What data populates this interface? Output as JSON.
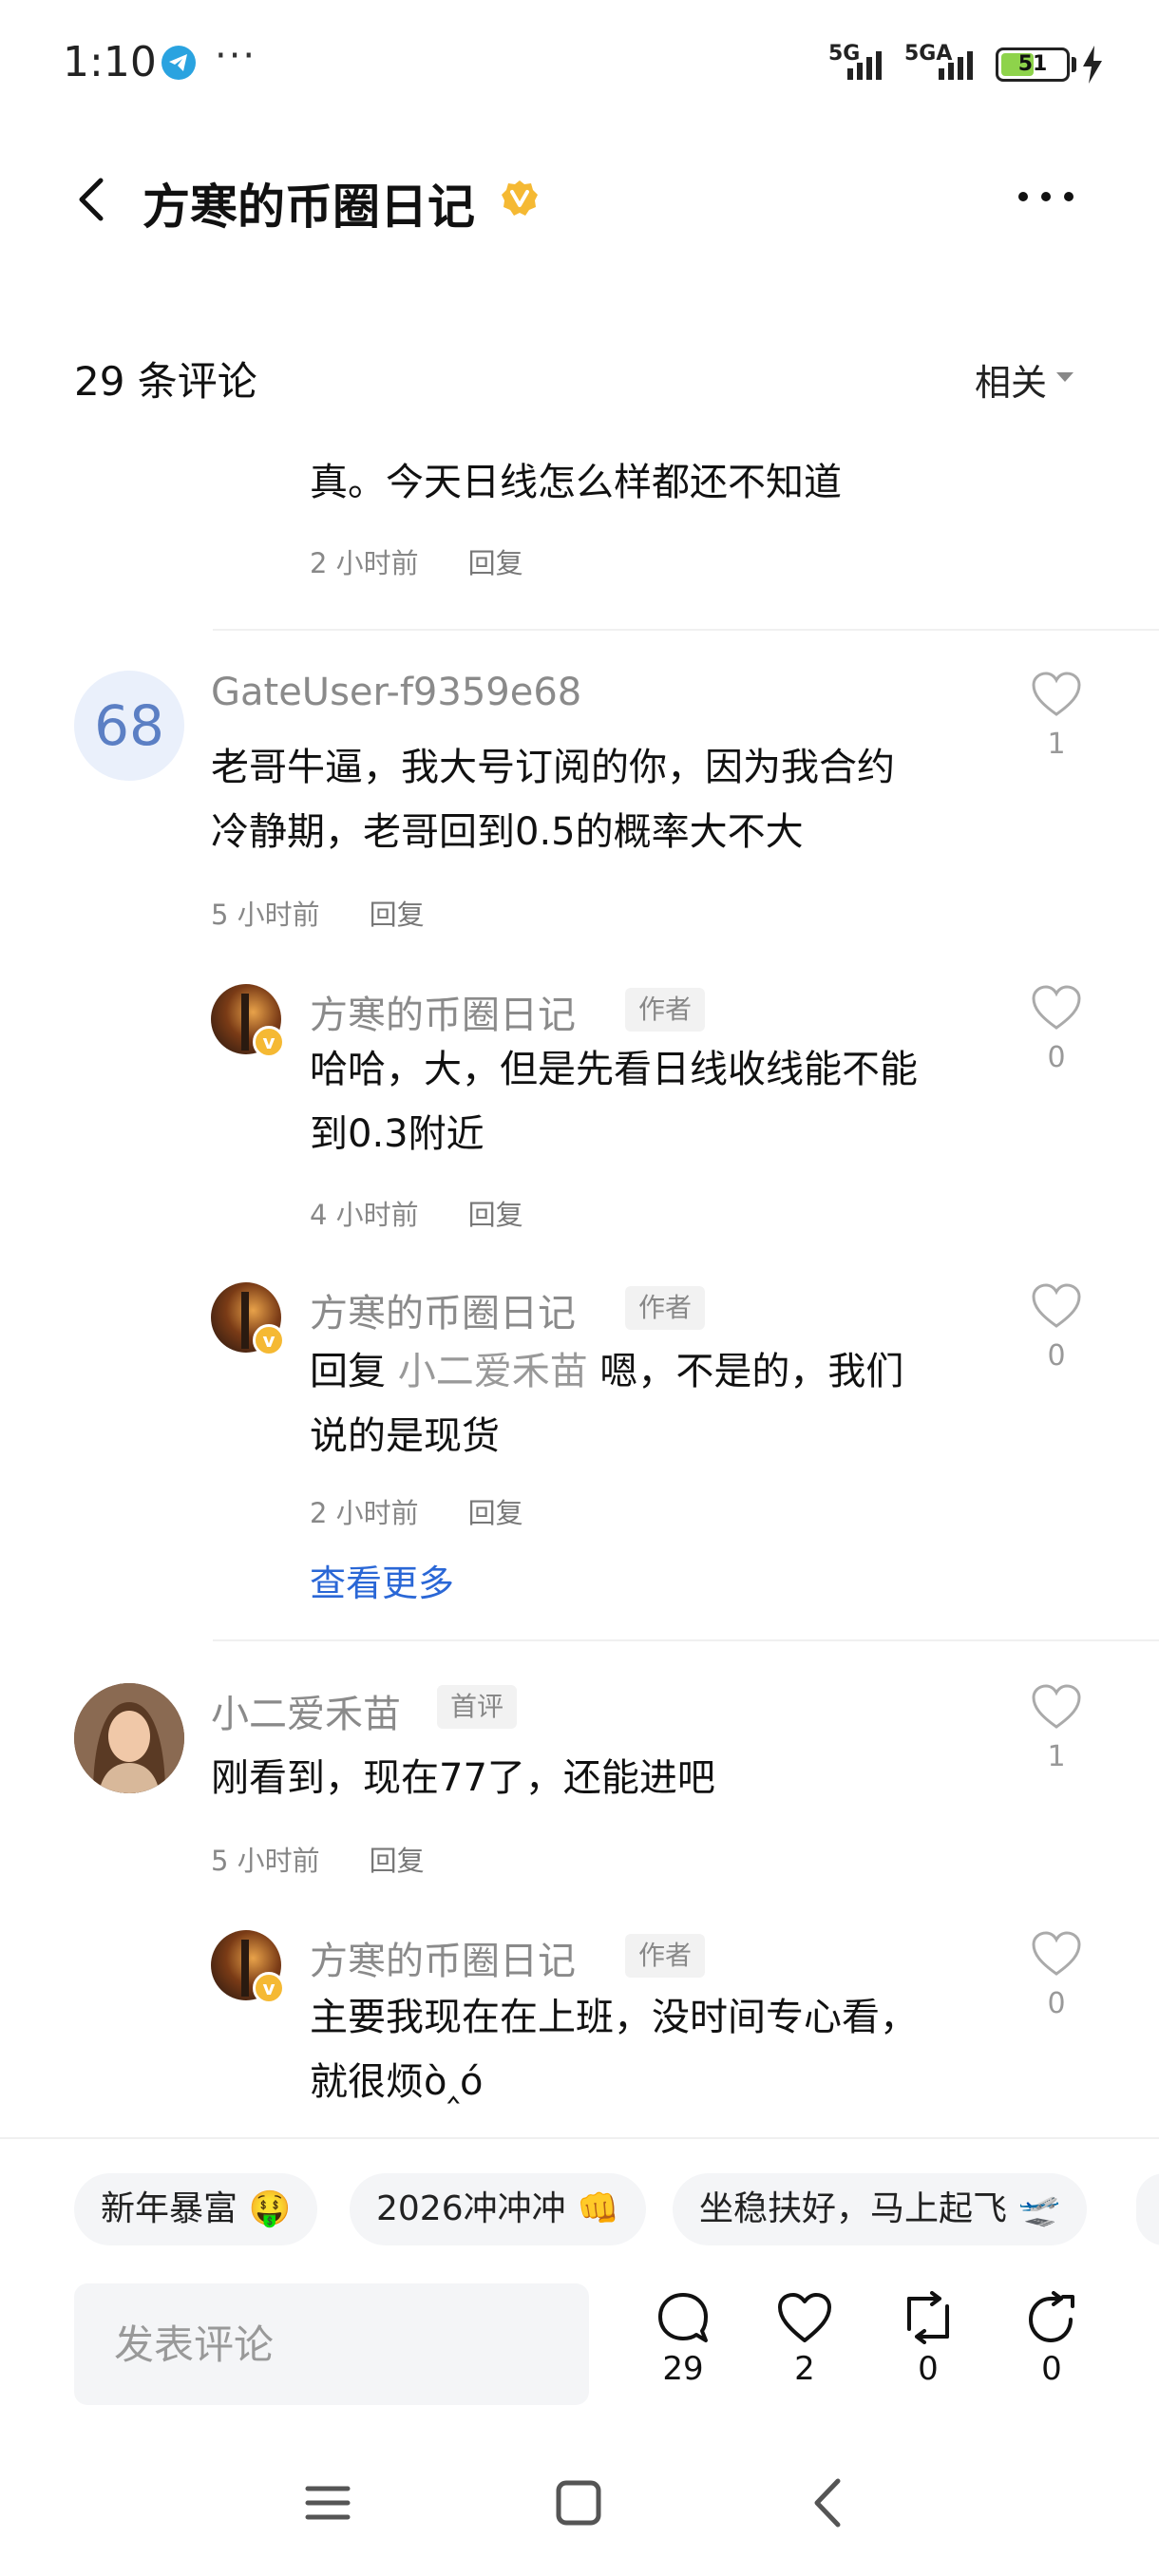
{
  "status_bar": {
    "time": "1:10",
    "dots": "···",
    "network1": "5G",
    "network2": "5GA",
    "battery": "51",
    "battery_level": 0.51
  },
  "header": {
    "title": "方寒的币圈日记"
  },
  "comments_header": {
    "count_label": "29 条评论",
    "sort_label": "相关"
  },
  "comments": {
    "partial": {
      "text": "真。今天日线怎么样都还不知道",
      "time": "2 小时前",
      "reply": "回复"
    },
    "c1": {
      "avatar_text": "68",
      "user": "GateUser-f9359e68",
      "line1": "老哥牛逼，我大号订阅的你，因为我合约",
      "line2": "冷静期，老哥回到0.5的概率大不大",
      "time": "5 小时前",
      "reply": "回复",
      "likes": "1"
    },
    "c1_r1": {
      "user": "方寒的币圈日记",
      "badge": "作者",
      "line1": "哈哈，大，但是先看日线收线能不能",
      "line2": "到0.3附近",
      "time": "4 小时前",
      "reply": "回复",
      "likes": "0"
    },
    "c1_r2": {
      "user": "方寒的币圈日记",
      "badge": "作者",
      "prefix": "回复 ",
      "mention": "小二爱禾苗",
      "line1_rest": " 嗯，不是的，我们",
      "line2": "说的是现货",
      "time": "2 小时前",
      "reply": "回复",
      "likes": "0"
    },
    "view_more": "查看更多",
    "c2": {
      "user": "小二爱禾苗",
      "badge": "首评",
      "text": "刚看到，现在77了，还能进吧",
      "time": "5 小时前",
      "reply": "回复",
      "likes": "1"
    },
    "c2_r1": {
      "user": "方寒的币圈日记",
      "badge": "作者",
      "line1": "主要我现在在上班，没时间专心看，",
      "line2": "就很烦ò‸ó",
      "likes": "0"
    }
  },
  "chips": [
    "新年暴富 🤑",
    "2026冲冲冲 👊",
    "坐稳扶好，马上起飞 🛫"
  ],
  "composer": {
    "placeholder": "发表评论"
  },
  "actions": {
    "comments": "29",
    "likes": "2",
    "reposts": "0",
    "shares": "0"
  },
  "colors": {
    "link": "#2a67d6",
    "verified": "#f5b933",
    "battery": "#8ed34b"
  }
}
